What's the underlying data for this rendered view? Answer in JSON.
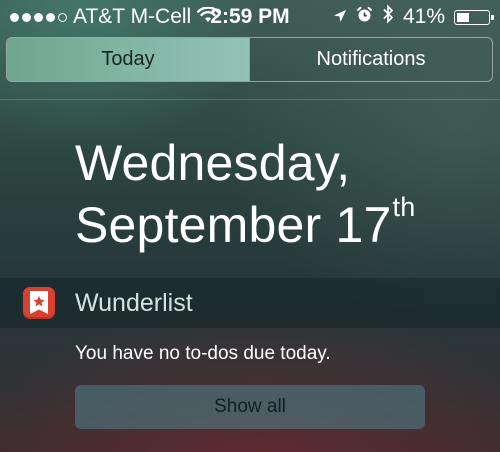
{
  "status_bar": {
    "carrier": "AT&T M-Cell",
    "time": "2:59 PM",
    "battery_percent": "41%",
    "battery_level": 0.41,
    "signal_bars_filled": 4,
    "signal_bars_total": 5,
    "icons": [
      "wifi-icon",
      "location-arrow-icon",
      "alarm-icon",
      "bluetooth-icon",
      "battery-icon"
    ]
  },
  "tabs": [
    {
      "label": "Today",
      "selected": true
    },
    {
      "label": "Notifications",
      "selected": false
    }
  ],
  "date": {
    "weekday": "Wednesday,",
    "month_day": "September 17",
    "suffix": "th"
  },
  "widget": {
    "app_name": "Wunderlist",
    "icon": "wunderlist-icon",
    "accent_color": "#d8412e",
    "message": "You have no to-dos due today.",
    "button_label": "Show all"
  }
}
